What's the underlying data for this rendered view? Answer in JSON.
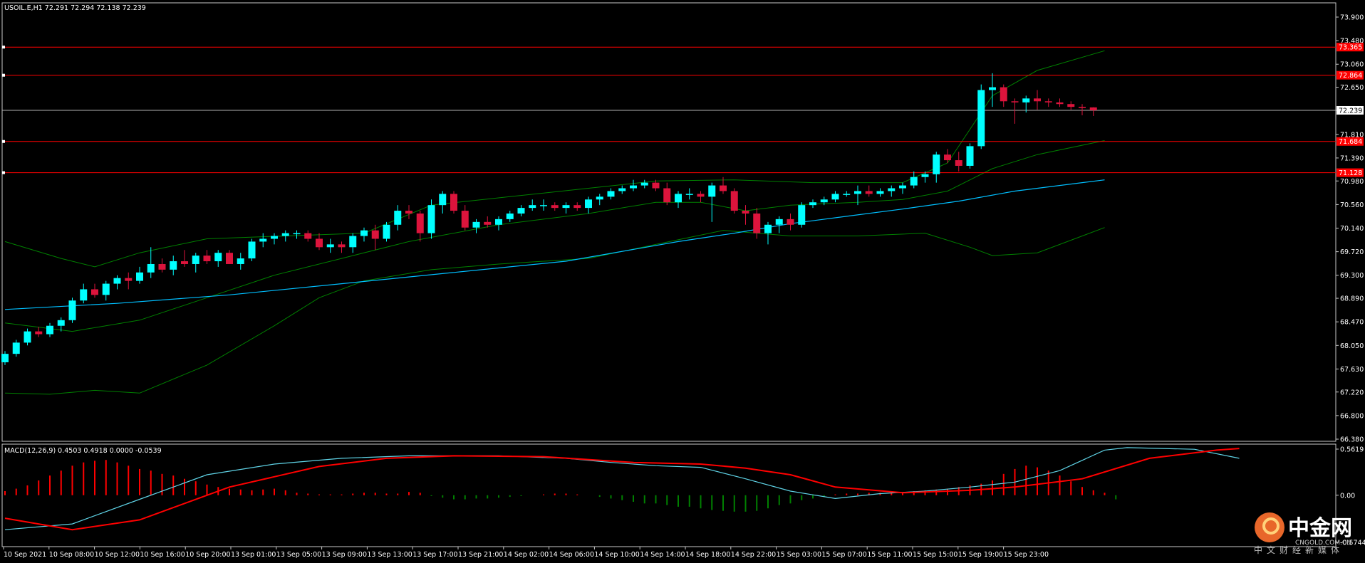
{
  "header": {
    "symbol_line": "USOIL.E,H1  72.291 72.294 72.138 72.239",
    "macd_line": "MACD(12,26,9) 0.4503 0.4918 0.0000 -0.0539"
  },
  "colors": {
    "background": "#000000",
    "bull_candle": "#00ffff",
    "bear_candle": "#dc143c",
    "bollinger": "#008000",
    "moving_average": "#00bfff",
    "level_line": "#ff0000",
    "current_price_line": "#b0b0b0",
    "macd_histogram_up": "#ff0000",
    "macd_histogram_down": "#008000",
    "macd_line": "#5fd3e6",
    "signal_line": "#ff0000"
  },
  "price_axis": {
    "ticks": [
      "73.900",
      "73.480",
      "73.060",
      "72.650",
      "72.239",
      "71.810",
      "71.390",
      "70.980",
      "70.560",
      "70.140",
      "69.720",
      "69.300",
      "68.890",
      "68.470",
      "68.050",
      "67.630",
      "67.220",
      "66.800",
      "66.380"
    ]
  },
  "levels": [
    {
      "tag": "73.365",
      "price": 73.365
    },
    {
      "tag": "72.864",
      "price": 72.864
    },
    {
      "tag": "71.684",
      "price": 71.684
    },
    {
      "tag": "71.128",
      "price": 71.128
    }
  ],
  "current_price": {
    "tag": "72.239",
    "price": 72.239
  },
  "macd_axis": {
    "ticks": [
      "0.5619",
      "0.00",
      "-0.5744"
    ]
  },
  "time_axis": {
    "labels": [
      "10 Sep 2021",
      "10 Sep 08:00",
      "10 Sep 12:00",
      "10 Sep 16:00",
      "10 Sep 20:00",
      "13 Sep 01:00",
      "13 Sep 05:00",
      "13 Sep 09:00",
      "13 Sep 13:00",
      "13 Sep 17:00",
      "13 Sep 21:00",
      "14 Sep 02:00",
      "14 Sep 06:00",
      "14 Sep 10:00",
      "14 Sep 14:00",
      "14 Sep 18:00",
      "14 Sep 22:00",
      "15 Sep 03:00",
      "15 Sep 07:00",
      "15 Sep 11:00",
      "15 Sep 15:00",
      "15 Sep 19:00",
      "15 Sep 23:00"
    ]
  },
  "watermark": {
    "cn": "中金网",
    "site": "CNGOLD.COM.CN",
    "cn_small": "中文财经新媒体"
  },
  "chart_data": {
    "type": "candlestick",
    "symbol": "USOIL.E",
    "timeframe": "H1",
    "price_range": [
      66.38,
      73.9
    ],
    "candles": [
      [
        67.75,
        67.95,
        67.7,
        67.9
      ],
      [
        67.9,
        68.15,
        67.85,
        68.1
      ],
      [
        68.1,
        68.35,
        68.05,
        68.3
      ],
      [
        68.3,
        68.38,
        68.2,
        68.25
      ],
      [
        68.25,
        68.45,
        68.2,
        68.4
      ],
      [
        68.4,
        68.55,
        68.3,
        68.5
      ],
      [
        68.5,
        68.9,
        68.45,
        68.85
      ],
      [
        68.85,
        69.15,
        68.8,
        69.05
      ],
      [
        69.05,
        69.15,
        68.9,
        68.95
      ],
      [
        68.95,
        69.2,
        68.85,
        69.15
      ],
      [
        69.15,
        69.3,
        69.05,
        69.25
      ],
      [
        69.25,
        69.35,
        69.05,
        69.2
      ],
      [
        69.2,
        69.45,
        69.15,
        69.35
      ],
      [
        69.35,
        69.8,
        69.25,
        69.5
      ],
      [
        69.5,
        69.6,
        69.35,
        69.4
      ],
      [
        69.4,
        69.65,
        69.3,
        69.55
      ],
      [
        69.55,
        69.75,
        69.45,
        69.5
      ],
      [
        69.5,
        69.7,
        69.35,
        69.65
      ],
      [
        69.65,
        69.75,
        69.5,
        69.55
      ],
      [
        69.55,
        69.75,
        69.45,
        69.7
      ],
      [
        69.7,
        69.75,
        69.5,
        69.5
      ],
      [
        69.5,
        69.7,
        69.4,
        69.6
      ],
      [
        69.6,
        69.95,
        69.55,
        69.9
      ],
      [
        69.9,
        70.05,
        69.8,
        69.95
      ],
      [
        69.95,
        70.05,
        69.85,
        70.0
      ],
      [
        70.0,
        70.1,
        69.9,
        70.05
      ],
      [
        70.05,
        70.1,
        69.95,
        70.05
      ],
      [
        70.05,
        70.1,
        69.9,
        69.95
      ],
      [
        69.95,
        70.05,
        69.75,
        69.8
      ],
      [
        69.8,
        69.95,
        69.7,
        69.85
      ],
      [
        69.85,
        69.9,
        69.7,
        69.8
      ],
      [
        69.8,
        70.05,
        69.7,
        70.0
      ],
      [
        70.0,
        70.15,
        69.9,
        70.1
      ],
      [
        70.1,
        70.2,
        69.75,
        69.95
      ],
      [
        69.95,
        70.25,
        69.9,
        70.2
      ],
      [
        70.2,
        70.55,
        70.1,
        70.45
      ],
      [
        70.45,
        70.55,
        70.3,
        70.4
      ],
      [
        70.4,
        70.45,
        69.9,
        70.05
      ],
      [
        70.05,
        70.65,
        69.95,
        70.55
      ],
      [
        70.55,
        70.8,
        70.4,
        70.75
      ],
      [
        70.75,
        70.8,
        70.4,
        70.45
      ],
      [
        70.45,
        70.55,
        70.1,
        70.15
      ],
      [
        70.15,
        70.3,
        70.05,
        70.25
      ],
      [
        70.25,
        70.35,
        70.15,
        70.2
      ],
      [
        70.2,
        70.35,
        70.1,
        70.3
      ],
      [
        70.3,
        70.45,
        70.25,
        70.4
      ],
      [
        70.4,
        70.55,
        70.35,
        70.5
      ],
      [
        70.5,
        70.65,
        70.45,
        70.55
      ],
      [
        70.55,
        70.65,
        70.45,
        70.55
      ],
      [
        70.55,
        70.6,
        70.45,
        70.5
      ],
      [
        70.5,
        70.6,
        70.4,
        70.55
      ],
      [
        70.55,
        70.6,
        70.45,
        70.5
      ],
      [
        70.5,
        70.7,
        70.4,
        70.65
      ],
      [
        70.65,
        70.75,
        70.55,
        70.7
      ],
      [
        70.7,
        70.85,
        70.65,
        70.8
      ],
      [
        70.8,
        70.9,
        70.75,
        70.85
      ],
      [
        70.85,
        71.0,
        70.8,
        70.9
      ],
      [
        70.9,
        71.0,
        70.85,
        70.95
      ],
      [
        70.95,
        71.0,
        70.8,
        70.85
      ],
      [
        70.85,
        70.95,
        70.55,
        70.6
      ],
      [
        70.6,
        70.8,
        70.5,
        70.75
      ],
      [
        70.75,
        70.85,
        70.65,
        70.75
      ],
      [
        70.75,
        70.8,
        70.6,
        70.7
      ],
      [
        70.7,
        70.95,
        70.25,
        70.9
      ],
      [
        70.9,
        71.05,
        70.75,
        70.8
      ],
      [
        70.8,
        70.85,
        70.4,
        70.45
      ],
      [
        70.45,
        70.55,
        70.2,
        70.4
      ],
      [
        70.4,
        70.5,
        69.95,
        70.05
      ],
      [
        70.05,
        70.25,
        69.85,
        70.2
      ],
      [
        70.2,
        70.35,
        70.05,
        70.3
      ],
      [
        70.3,
        70.4,
        70.1,
        70.2
      ],
      [
        70.2,
        70.6,
        70.15,
        70.55
      ],
      [
        70.55,
        70.65,
        70.5,
        70.6
      ],
      [
        70.6,
        70.7,
        70.55,
        70.65
      ],
      [
        70.65,
        70.8,
        70.6,
        70.75
      ],
      [
        70.75,
        70.8,
        70.7,
        70.75
      ],
      [
        70.75,
        70.9,
        70.55,
        70.8
      ],
      [
        70.8,
        70.9,
        70.7,
        70.75
      ],
      [
        70.75,
        70.85,
        70.7,
        70.8
      ],
      [
        70.8,
        70.9,
        70.7,
        70.85
      ],
      [
        70.85,
        70.95,
        70.75,
        70.9
      ],
      [
        70.9,
        71.15,
        70.85,
        71.05
      ],
      [
        71.05,
        71.15,
        70.95,
        71.1
      ],
      [
        71.1,
        71.5,
        70.95,
        71.45
      ],
      [
        71.45,
        71.55,
        71.3,
        71.35
      ],
      [
        71.35,
        71.5,
        71.15,
        71.25
      ],
      [
        71.25,
        71.65,
        71.2,
        71.6
      ],
      [
        71.6,
        72.7,
        71.55,
        72.6
      ],
      [
        72.6,
        72.9,
        72.3,
        72.65
      ],
      [
        72.65,
        72.7,
        72.3,
        72.4
      ],
      [
        72.4,
        72.45,
        72.0,
        72.38
      ],
      [
        72.38,
        72.5,
        72.2,
        72.45
      ],
      [
        72.45,
        72.6,
        72.25,
        72.4
      ],
      [
        72.4,
        72.45,
        72.3,
        72.38
      ],
      [
        72.38,
        72.45,
        72.3,
        72.35
      ],
      [
        72.35,
        72.4,
        72.25,
        72.3
      ],
      [
        72.3,
        72.35,
        72.15,
        72.28
      ],
      [
        72.291,
        72.294,
        72.138,
        72.239
      ]
    ],
    "moving_average": [
      [
        0,
        68.69
      ],
      [
        10,
        68.8
      ],
      [
        20,
        68.95
      ],
      [
        30,
        69.15
      ],
      [
        40,
        69.35
      ],
      [
        50,
        69.55
      ],
      [
        60,
        69.9
      ],
      [
        65,
        70.05
      ],
      [
        70,
        70.22
      ],
      [
        75,
        70.35
      ],
      [
        80,
        70.48
      ],
      [
        85,
        70.62
      ],
      [
        90,
        70.8
      ],
      [
        98,
        71.0
      ]
    ],
    "bollinger_upper": [
      [
        0,
        69.9
      ],
      [
        5,
        69.6
      ],
      [
        8,
        69.45
      ],
      [
        12,
        69.7
      ],
      [
        18,
        69.95
      ],
      [
        25,
        70.0
      ],
      [
        32,
        70.05
      ],
      [
        38,
        70.55
      ],
      [
        45,
        70.7
      ],
      [
        52,
        70.85
      ],
      [
        58,
        70.98
      ],
      [
        65,
        71.0
      ],
      [
        72,
        70.95
      ],
      [
        80,
        70.95
      ],
      [
        84,
        71.3
      ],
      [
        88,
        72.5
      ],
      [
        92,
        72.95
      ],
      [
        98,
        73.3
      ]
    ],
    "bollinger_middle": [
      [
        0,
        68.45
      ],
      [
        6,
        68.3
      ],
      [
        12,
        68.5
      ],
      [
        18,
        68.9
      ],
      [
        24,
        69.3
      ],
      [
        30,
        69.6
      ],
      [
        36,
        69.9
      ],
      [
        44,
        70.2
      ],
      [
        52,
        70.4
      ],
      [
        58,
        70.6
      ],
      [
        62,
        70.6
      ],
      [
        66,
        70.45
      ],
      [
        70,
        70.55
      ],
      [
        76,
        70.6
      ],
      [
        80,
        70.65
      ],
      [
        84,
        70.8
      ],
      [
        88,
        71.2
      ],
      [
        92,
        71.45
      ],
      [
        98,
        71.7
      ]
    ],
    "bollinger_lower": [
      [
        0,
        67.2
      ],
      [
        4,
        67.18
      ],
      [
        8,
        67.25
      ],
      [
        12,
        67.2
      ],
      [
        18,
        67.7
      ],
      [
        24,
        68.4
      ],
      [
        28,
        68.9
      ],
      [
        32,
        69.2
      ],
      [
        38,
        69.4
      ],
      [
        44,
        69.5
      ],
      [
        52,
        69.6
      ],
      [
        58,
        69.85
      ],
      [
        64,
        70.1
      ],
      [
        70,
        70.0
      ],
      [
        76,
        70.0
      ],
      [
        82,
        70.05
      ],
      [
        86,
        69.8
      ],
      [
        88,
        69.65
      ],
      [
        92,
        69.7
      ],
      [
        98,
        70.15
      ]
    ],
    "macd": {
      "range": [
        -0.5744,
        0.5619
      ],
      "histogram": [
        0.05,
        0.08,
        0.12,
        0.18,
        0.24,
        0.3,
        0.36,
        0.4,
        0.42,
        0.43,
        0.4,
        0.36,
        0.32,
        0.3,
        0.26,
        0.24,
        0.2,
        0.17,
        0.13,
        0.1,
        0.08,
        0.07,
        0.06,
        0.07,
        0.08,
        0.06,
        0.03,
        0.02,
        0.01,
        0.01,
        0.01,
        0.02,
        0.03,
        0.03,
        0.02,
        0.02,
        0.04,
        0.03,
        -0.01,
        -0.03,
        -0.05,
        -0.05,
        -0.04,
        -0.04,
        -0.03,
        -0.02,
        -0.01,
        0.0,
        0.01,
        0.02,
        0.02,
        0.01,
        0.0,
        -0.02,
        -0.04,
        -0.06,
        -0.08,
        -0.1,
        -0.1,
        -0.12,
        -0.14,
        -0.14,
        -0.16,
        -0.18,
        -0.19,
        -0.2,
        -0.2,
        -0.19,
        -0.16,
        -0.12,
        -0.1,
        -0.06,
        -0.04,
        -0.02,
        0.01,
        0.02,
        0.02,
        0.03,
        0.03,
        0.03,
        0.04,
        0.05,
        0.06,
        0.07,
        0.08,
        0.1,
        0.12,
        0.14,
        0.18,
        0.26,
        0.32,
        0.36,
        0.34,
        0.3,
        0.24,
        0.17,
        0.1,
        0.06,
        0.03,
        -0.05
      ],
      "macd_line": [
        [
          0,
          -0.42
        ],
        [
          6,
          -0.35
        ],
        [
          12,
          -0.05
        ],
        [
          18,
          0.25
        ],
        [
          24,
          0.38
        ],
        [
          30,
          0.45
        ],
        [
          36,
          0.48
        ],
        [
          44,
          0.48
        ],
        [
          50,
          0.45
        ],
        [
          54,
          0.4
        ],
        [
          58,
          0.36
        ],
        [
          62,
          0.34
        ],
        [
          66,
          0.2
        ],
        [
          70,
          0.05
        ],
        [
          74,
          -0.04
        ],
        [
          78,
          0.02
        ],
        [
          82,
          0.05
        ],
        [
          86,
          0.1
        ],
        [
          90,
          0.16
        ],
        [
          94,
          0.3
        ],
        [
          98,
          0.55
        ],
        [
          100,
          0.58
        ],
        [
          106,
          0.56
        ],
        [
          110,
          0.45
        ]
      ],
      "signal_line": [
        [
          0,
          -0.28
        ],
        [
          6,
          -0.42
        ],
        [
          12,
          -0.3
        ],
        [
          20,
          0.1
        ],
        [
          28,
          0.35
        ],
        [
          34,
          0.45
        ],
        [
          40,
          0.48
        ],
        [
          48,
          0.47
        ],
        [
          56,
          0.4
        ],
        [
          62,
          0.38
        ],
        [
          66,
          0.33
        ],
        [
          70,
          0.25
        ],
        [
          74,
          0.1
        ],
        [
          80,
          0.03
        ],
        [
          86,
          0.06
        ],
        [
          90,
          0.1
        ],
        [
          96,
          0.2
        ],
        [
          102,
          0.45
        ],
        [
          108,
          0.55
        ],
        [
          110,
          0.57
        ]
      ]
    }
  }
}
